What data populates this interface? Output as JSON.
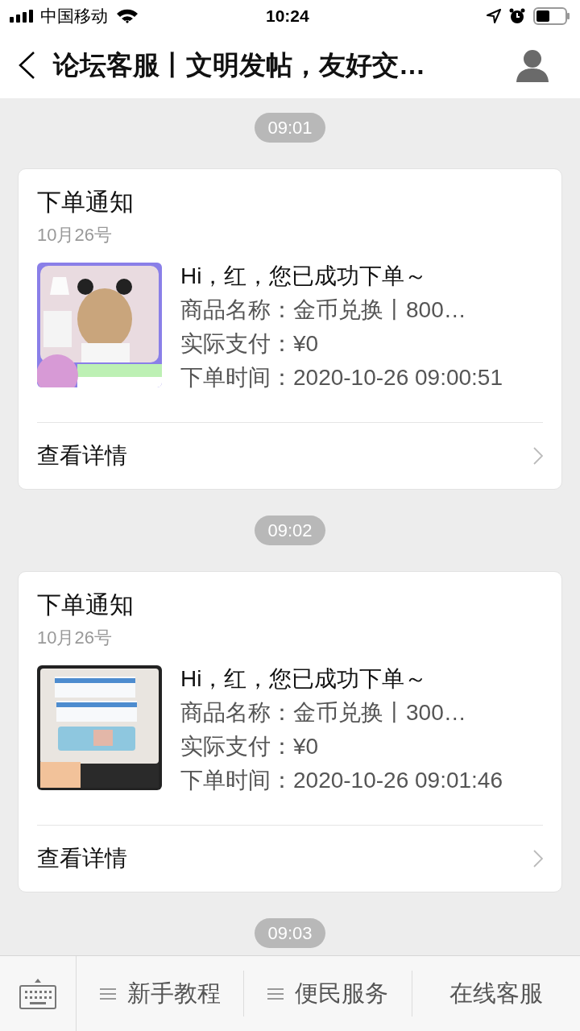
{
  "status_bar": {
    "carrier": "中国移动",
    "time": "10:24"
  },
  "nav": {
    "title": "论坛客服丨文明发帖，友好交…"
  },
  "chat": [
    {
      "kind": "time",
      "text": "09:01"
    },
    {
      "kind": "order",
      "title": "下单通知",
      "date": "10月26号",
      "lines": [
        "Hi，红，您已成功下单～",
        "商品名称：金币兑换丨800…",
        "实际支付：¥0",
        "下单时间：2020-10-26 09:00:51"
      ],
      "link": "查看详情"
    },
    {
      "kind": "time",
      "text": "09:02"
    },
    {
      "kind": "order",
      "title": "下单通知",
      "date": "10月26号",
      "lines": [
        "Hi，红，您已成功下单～",
        "商品名称：金币兑换丨300…",
        "实际支付：¥0",
        "下单时间：2020-10-26 09:01:46"
      ],
      "link": "查看详情"
    },
    {
      "kind": "time",
      "text": "09:03"
    }
  ],
  "menu": [
    {
      "kind": "submenu",
      "label": "新手教程"
    },
    {
      "kind": "submenu",
      "label": "便民服务"
    },
    {
      "kind": "plain",
      "label": "在线客服"
    }
  ]
}
